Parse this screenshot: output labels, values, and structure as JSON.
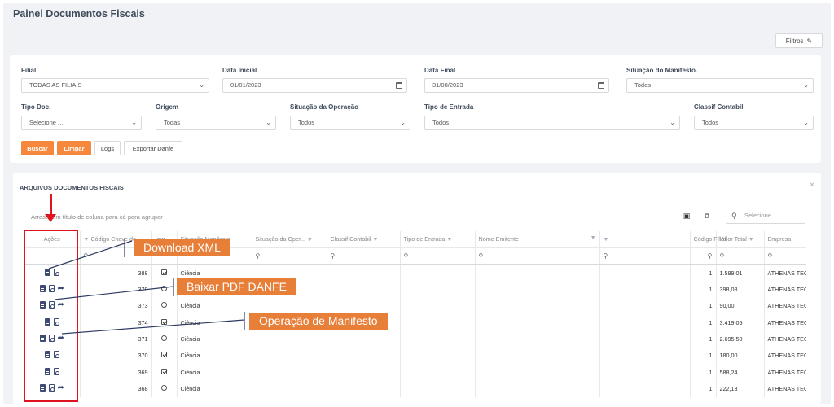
{
  "page": {
    "title": "Painel Documentos Fiscais",
    "filters_button": "Filtros"
  },
  "filters": {
    "filial": {
      "label": "Filial",
      "value": "TODAS AS FILIAIS"
    },
    "data_inicial": {
      "label": "Data Inicial",
      "value": "01/01/2023"
    },
    "data_final": {
      "label": "Data Final",
      "value": "31/08/2023"
    },
    "situacao_manifesto": {
      "label": "Situação do Manifesto.",
      "value": "Todos"
    },
    "tipo_doc": {
      "label": "Tipo Doc.",
      "value": "Selecione ..."
    },
    "origem": {
      "label": "Origem",
      "value": "Todas"
    },
    "situacao_operacao": {
      "label": "Situação da Operação",
      "value": "Todos"
    },
    "tipo_entrada": {
      "label": "Tipo de Entrada",
      "value": "Todos"
    },
    "classif_contabil": {
      "label": "Classif Contabil",
      "value": "Todos"
    },
    "buttons": {
      "buscar": "Buscar",
      "limpar": "Limpar",
      "logs": "Logs",
      "exportar": "Exportar Danfe"
    }
  },
  "grid": {
    "title": "ARQUIVOS DOCUMENTOS FISCAIS",
    "group_hint": "Arraste um título de coluna para cá para agrupar",
    "search_placeholder": "Selecione",
    "columns": [
      "Ações",
      "Código Chave do",
      "Imp",
      "Situação Manifesto",
      "Situação da Oper...",
      "Classif Contabil",
      "Tipo de Entrada",
      "Nome Emitente",
      "",
      "Código Filial",
      "Valor Total",
      "Empresa"
    ],
    "rows": [
      {
        "codigo": "388",
        "imp": "check",
        "situacao": "Ciência",
        "filial": "1",
        "valor": "1.589,01",
        "empresa": "ATHENAS TECNC",
        "share": false
      },
      {
        "codigo": "379",
        "imp": "circle",
        "situacao": "Ciência",
        "filial": "1",
        "valor": "398,08",
        "empresa": "ATHENAS TECNC",
        "share": true
      },
      {
        "codigo": "373",
        "imp": "circle",
        "situacao": "Ciência",
        "filial": "1",
        "valor": "90,00",
        "empresa": "ATHENAS TECNC",
        "share": true
      },
      {
        "codigo": "374",
        "imp": "check",
        "situacao": "Ciência",
        "filial": "1",
        "valor": "3.419,05",
        "empresa": "ATHENAS TECNC",
        "share": false
      },
      {
        "codigo": "371",
        "imp": "circle",
        "situacao": "Ciência",
        "filial": "1",
        "valor": "2.695,50",
        "empresa": "ATHENAS TECNC",
        "share": true
      },
      {
        "codigo": "370",
        "imp": "check",
        "situacao": "Ciência",
        "filial": "1",
        "valor": "180,00",
        "empresa": "ATHENAS TECNC",
        "share": false
      },
      {
        "codigo": "369",
        "imp": "check",
        "situacao": "Ciência",
        "filial": "1",
        "valor": "588,24",
        "empresa": "ATHENAS TECNC",
        "share": false
      },
      {
        "codigo": "368",
        "imp": "circle",
        "situacao": "Ciência",
        "filial": "1",
        "valor": "222,13",
        "empresa": "ATHENAS TECNC",
        "share": true
      }
    ]
  },
  "annotations": {
    "download_xml": "Download XML",
    "baixar_pdf": "Baixar PDF DANFE",
    "operacao_manifesto": "Operação de Manifesto"
  },
  "colors": {
    "accent": "#f5883d",
    "callout": "#e87f39",
    "highlight": "#e0141e",
    "icon": "#3c4a74"
  }
}
